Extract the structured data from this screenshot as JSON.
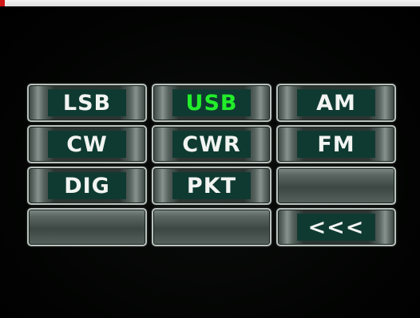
{
  "screen": {
    "title": "",
    "active_mode": "USB",
    "colors": {
      "active_text": "#22ee2a",
      "text": "#f2f4f2",
      "button_face": "#0f3a31",
      "background": "#000000"
    }
  },
  "mode_buttons": {
    "lsb": "LSB",
    "usb": "USB",
    "am": "AM",
    "cw": "CW",
    "cwr": "CWR",
    "fm": "FM",
    "dig": "DIG",
    "pkt": "PKT",
    "back": "<<<"
  }
}
